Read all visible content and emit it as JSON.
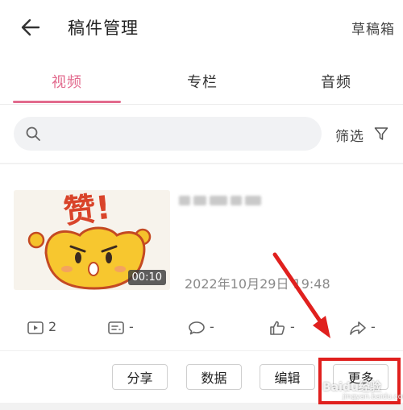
{
  "header": {
    "title": "稿件管理",
    "drafts_label": "草稿箱",
    "back_icon": "back-arrow-icon"
  },
  "tabs": [
    {
      "label": "视频",
      "active": true
    },
    {
      "label": "专栏",
      "active": false
    },
    {
      "label": "音频",
      "active": false
    }
  ],
  "search": {
    "placeholder": "",
    "icon": "search-icon"
  },
  "filter": {
    "label": "筛选",
    "icon": "filter-icon"
  },
  "video": {
    "thumbnail_text": "赞!",
    "duration": "00:10",
    "publish_time": "2022年10月29日 19:48",
    "stats": [
      {
        "icon": "play-icon",
        "value": "2"
      },
      {
        "icon": "danmaku-icon",
        "value": "-"
      },
      {
        "icon": "comment-icon",
        "value": "-"
      },
      {
        "icon": "like-icon",
        "value": "-"
      },
      {
        "icon": "share-icon",
        "value": "-"
      }
    ],
    "actions": {
      "share": "分享",
      "data": "数据",
      "edit": "编辑",
      "more": "更多"
    }
  },
  "colors": {
    "accent": "#e26a8d",
    "annotation": "#e0201e"
  },
  "watermark": {
    "main": "Baidu经验",
    "sub": "jingyan.baidu.com"
  }
}
